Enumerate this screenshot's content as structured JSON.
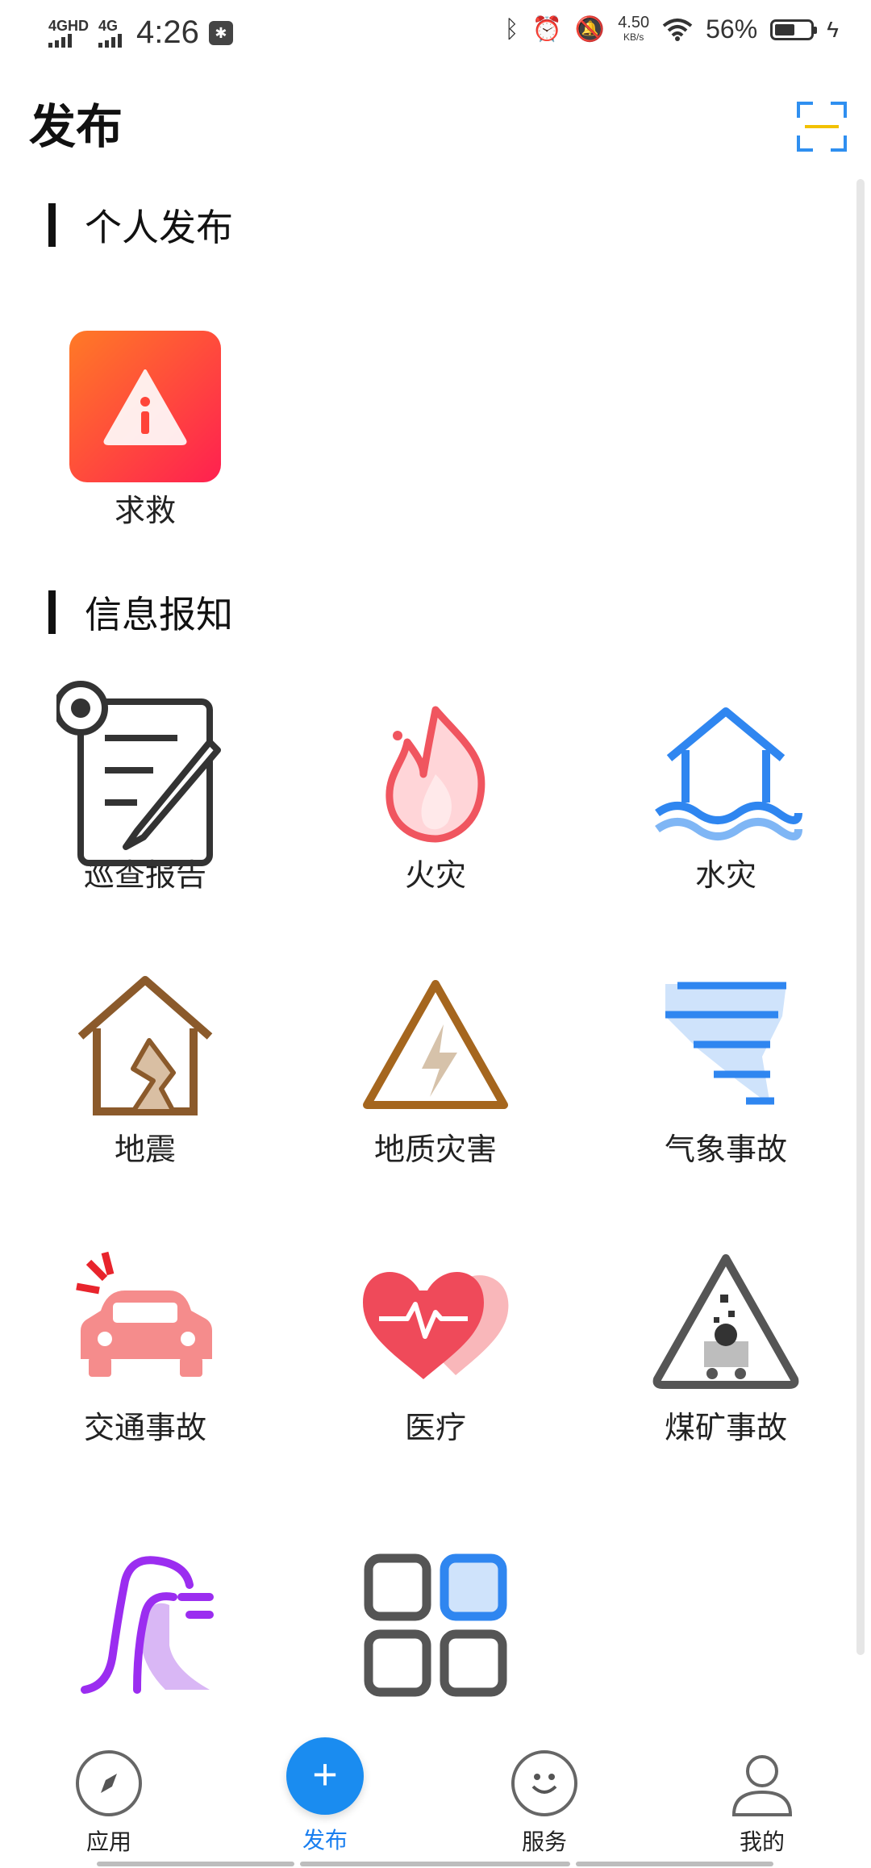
{
  "status_bar": {
    "network1": "4GHD",
    "network2": "4G",
    "time": "4:26",
    "speed_value": "4.50",
    "speed_unit": "KB/s",
    "battery_percent": "56%",
    "battery_level": 0.56
  },
  "header": {
    "title": "发布"
  },
  "sections": {
    "personal": {
      "title": "个人发布",
      "items": [
        {
          "label": "求救",
          "icon": "sos-warning-icon"
        }
      ]
    },
    "report": {
      "title": "信息报知",
      "items": [
        {
          "label": "巡查报告",
          "icon": "patrol-report-icon"
        },
        {
          "label": "火灾",
          "icon": "fire-icon"
        },
        {
          "label": "水灾",
          "icon": "flood-icon"
        },
        {
          "label": "地震",
          "icon": "earthquake-icon"
        },
        {
          "label": "地质灾害",
          "icon": "geological-hazard-icon"
        },
        {
          "label": "气象事故",
          "icon": "weather-icon"
        },
        {
          "label": "交通事故",
          "icon": "car-accident-icon"
        },
        {
          "label": "医疗",
          "icon": "medical-heart-icon"
        },
        {
          "label": "煤矿事故",
          "icon": "coal-mine-icon"
        },
        {
          "label": "",
          "icon": "landslide-icon"
        },
        {
          "label": "",
          "icon": "more-grid-icon"
        }
      ]
    }
  },
  "bottom_nav": {
    "apps": "应用",
    "publish": "发布",
    "publish_symbol": "+",
    "services": "服务",
    "mine": "我的"
  },
  "colors": {
    "accent": "#1a8cf0",
    "sos_gradient_start": "#ff7a26",
    "sos_gradient_end": "#ff2050"
  }
}
